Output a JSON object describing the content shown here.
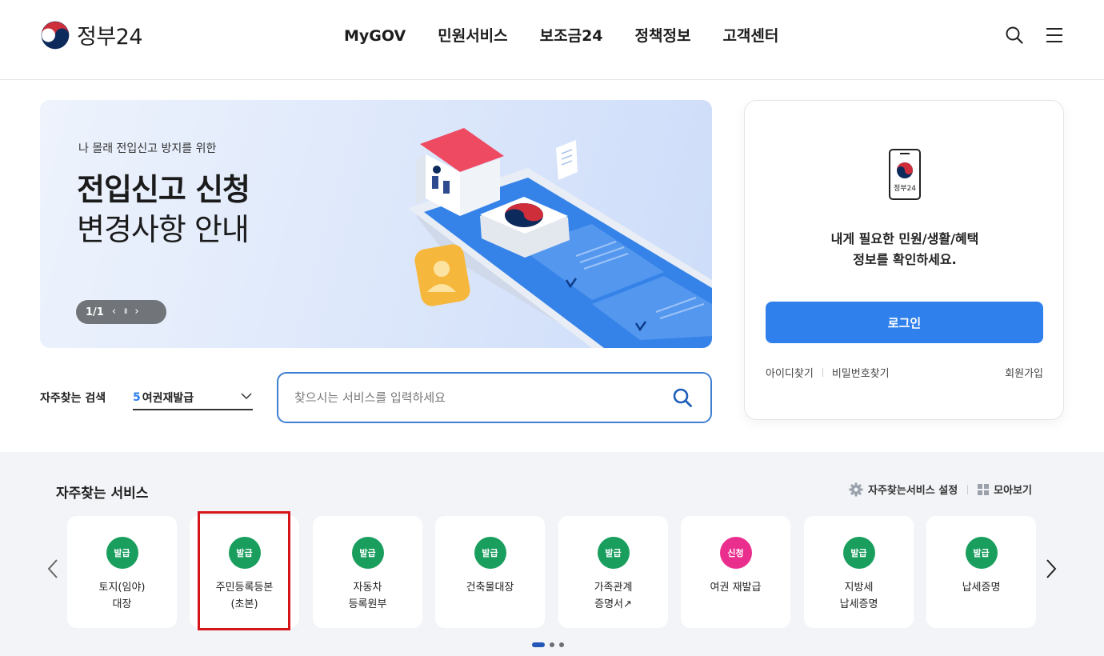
{
  "header": {
    "logo_text": "정부24",
    "nav": [
      "MyGOV",
      "민원서비스",
      "보조금24",
      "정책정보",
      "고객센터"
    ],
    "search_icon": "search-icon",
    "menu_icon": "menu-icon"
  },
  "banner": {
    "subtitle": "나 몰래 전입신고 방지를 위한",
    "title_line1": "전입신고 신청",
    "title_line2": "변경사항 안내",
    "counter": "1/1",
    "prev_symbol": "‹",
    "pause_symbol": "II",
    "next_symbol": "›"
  },
  "login": {
    "phone_label": "정부24",
    "message_line1": "내게 필요한 민원/생활/혜택",
    "message_line2": "정보를 확인하세요.",
    "button": "로그인",
    "find_id": "아이디찾기",
    "find_pw": "비밀번호찾기",
    "signup": "회원가입"
  },
  "search": {
    "label": "자주찾는 검색",
    "keyword_rank": "5",
    "keyword_text": "여권재발급",
    "placeholder": "찾으시는 서비스를 입력하세요"
  },
  "favorites": {
    "title": "자주찾는 서비스",
    "settings": "자주찾는서비스 설정",
    "view_all": "모아보기",
    "cards": [
      {
        "badge": "발급",
        "label": "토지(임야)\n대장",
        "color": "green"
      },
      {
        "badge": "발급",
        "label": "주민등록등본\n(초본)",
        "color": "green"
      },
      {
        "badge": "발급",
        "label": "자동차\n등록원부",
        "color": "green"
      },
      {
        "badge": "발급",
        "label": "건축물대장",
        "color": "green"
      },
      {
        "badge": "발급",
        "label": "가족관계\n증명서↗",
        "color": "green"
      },
      {
        "badge": "신청",
        "label": "여권 재발급",
        "color": "pink"
      },
      {
        "badge": "발급",
        "label": "지방세\n납세증명",
        "color": "green"
      },
      {
        "badge": "발급",
        "label": "납세증명",
        "color": "green"
      }
    ],
    "pager": {
      "pages": 3,
      "current": 1
    }
  },
  "colors": {
    "accent": "#2f80ed",
    "badge_green": "#1a9e5e",
    "badge_pink": "#ea2e8e",
    "highlight": "#d6151b"
  }
}
